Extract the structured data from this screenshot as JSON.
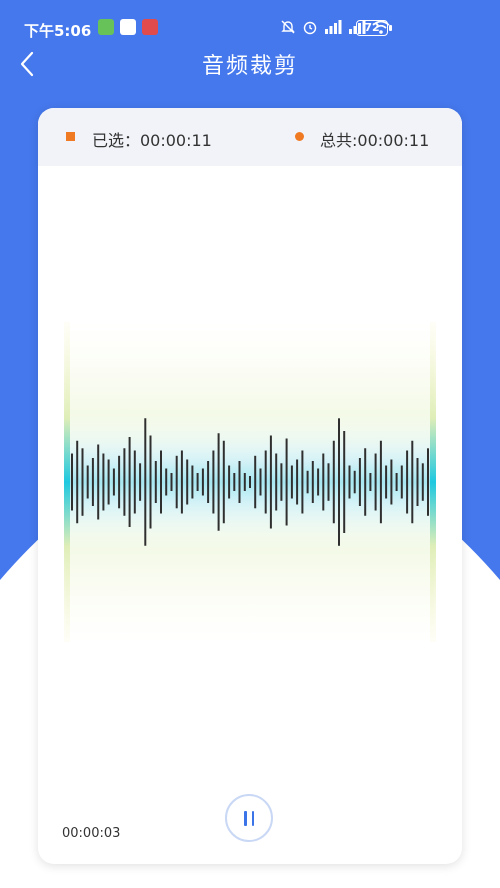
{
  "colors": {
    "primary": "#4578ed",
    "accent": "#f07a24",
    "waveform": "#2f2f2f",
    "playhead": "#1ec8e0"
  },
  "status_bar": {
    "time": "下午5:06",
    "battery": "72",
    "icons": [
      "shield-icon",
      "app-icon",
      "app-icon",
      "mute-bell-icon",
      "alarm-icon",
      "signal-icon",
      "signal-icon",
      "wifi-icon",
      "battery-icon"
    ]
  },
  "nav": {
    "back_icon": "chevron-left-icon",
    "title": "音频裁剪"
  },
  "card": {
    "selected_label": "已选：00:00:11",
    "total_label": "总共:00:00:11",
    "current_time": "00:00:03",
    "play_state": "pause-icon"
  },
  "waveform": {
    "amplitudes": [
      0.38,
      0.55,
      0.45,
      0.22,
      0.32,
      0.5,
      0.38,
      0.3,
      0.18,
      0.35,
      0.45,
      0.6,
      0.42,
      0.25,
      0.85,
      0.62,
      0.28,
      0.42,
      0.18,
      0.12,
      0.35,
      0.42,
      0.3,
      0.22,
      0.12,
      0.18,
      0.28,
      0.42,
      0.65,
      0.55,
      0.22,
      0.12,
      0.28,
      0.12,
      0.08,
      0.35,
      0.18,
      0.42,
      0.62,
      0.38,
      0.25,
      0.58,
      0.22,
      0.3,
      0.42,
      0.15,
      0.28,
      0.18,
      0.38,
      0.25,
      0.55,
      0.85,
      0.68,
      0.22,
      0.15,
      0.32,
      0.45,
      0.12,
      0.38,
      0.55,
      0.22,
      0.3,
      0.12,
      0.22,
      0.42,
      0.55,
      0.32,
      0.25,
      0.45
    ]
  }
}
